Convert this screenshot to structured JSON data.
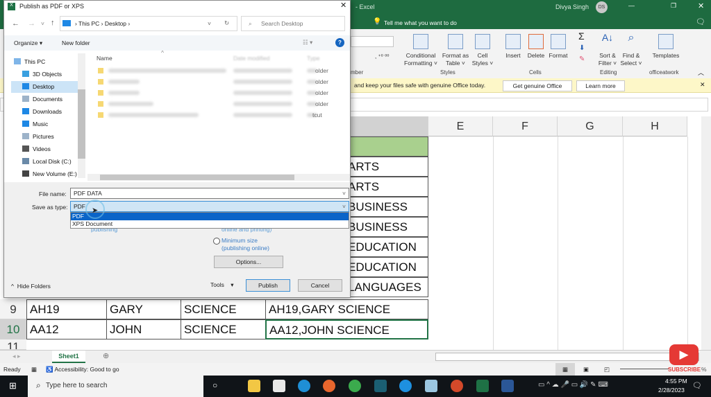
{
  "excel": {
    "title": "- Excel",
    "user": "Divya Singh",
    "avatar": "DS",
    "tell_me": "Tell me what you want to do",
    "ribbon": {
      "styles": [
        {
          "label": "Conditional Formatting ˅"
        },
        {
          "label": "Format as Table ˅"
        },
        {
          "label": "Cell Styles ˅"
        }
      ],
      "cells": [
        {
          "label": "Insert"
        },
        {
          "label": "Delete"
        },
        {
          "label": "Format"
        }
      ],
      "editing": [
        {
          "label": "Sort & Filter ˅"
        },
        {
          "label": "Find & Select ˅"
        }
      ],
      "templates": "Templates",
      "groups": {
        "number": "mber",
        "styles": "Styles",
        "cells": "Cells",
        "editing": "Editing",
        "officeatwork": "officeatwork"
      }
    },
    "banner": {
      "text": "and keep your files safe with genuine Office today.",
      "get": "Get genuine Office",
      "learn": "Learn more"
    },
    "columns": [
      "E",
      "F",
      "G",
      "H"
    ],
    "rows": [
      {
        "n": "9",
        "a": "AH19",
        "b": "GARY",
        "c": "SCIENCE",
        "d": "AH19,GARY  SCIENCE"
      },
      {
        "n": "10",
        "a": "AA12",
        "b": "JOHN",
        "c": "SCIENCE",
        "d": "AA12,JOHN  SCIENCE"
      },
      {
        "n": "11"
      }
    ],
    "d_partial": [
      "ARTS",
      "ARTS",
      " BUSINESS",
      "BUSINESS",
      "EDUCATION",
      "EDUCATION",
      "LANGUAGES"
    ],
    "sheet_tab": "Sheet1",
    "status": {
      "ready": "Ready",
      "accessibility": "Accessibility: Good to go"
    },
    "zoom_label": "%"
  },
  "dialog": {
    "title": "Publish as PDF or XPS",
    "breadcrumb": [
      "This PC",
      "Desktop"
    ],
    "search_placeholder": "Search Desktop",
    "organize": "Organize ▾",
    "new_folder": "New folder",
    "nav": [
      "This PC",
      "3D Objects",
      "Desktop",
      "Documents",
      "Downloads",
      "Music",
      "Pictures",
      "Videos",
      "Local Disk (C:)",
      "New Volume (E:)"
    ],
    "columns": {
      "name": "Name",
      "date": "Date modified",
      "type": "Type"
    },
    "file_types": [
      "older",
      "older",
      "older",
      "older",
      "tcut"
    ],
    "file_name_label": "File name:",
    "file_name": "PDF DATA",
    "save_type_label": "Save as type:",
    "save_type": "PDF",
    "type_options": [
      "PDF",
      "XPS Document"
    ],
    "publishing": "publishing",
    "online_printing": "online and printing)",
    "min_size": "Minimum size",
    "min_size_sub": "(publishing online)",
    "options": "Options...",
    "hide_folders": "Hide Folders",
    "tools": "Tools",
    "publish": "Publish",
    "cancel": "Cancel"
  },
  "taskbar": {
    "search": "Type here to search",
    "time": "4:55 PM",
    "date": "2/28/2023"
  },
  "overlay": {
    "subscribe": "SUBSCRIBE"
  }
}
